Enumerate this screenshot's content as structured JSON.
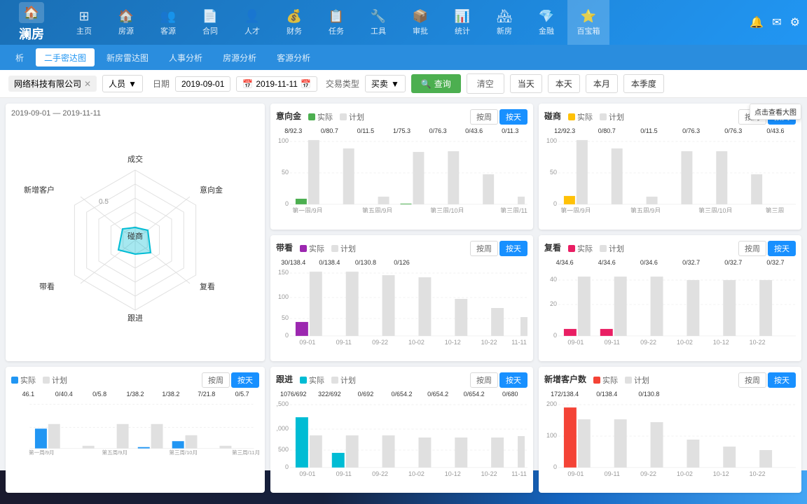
{
  "logo": {
    "name": "澜房",
    "icon": "🏠"
  },
  "nav": {
    "items": [
      {
        "id": "home",
        "icon": "⊞",
        "label": "主页"
      },
      {
        "id": "house",
        "icon": "🏠",
        "label": "房源"
      },
      {
        "id": "customer",
        "icon": "👥",
        "label": "客源"
      },
      {
        "id": "contract",
        "icon": "📄",
        "label": "合同"
      },
      {
        "id": "staff",
        "icon": "👤",
        "label": "人才"
      },
      {
        "id": "finance",
        "icon": "💰",
        "label": "财务"
      },
      {
        "id": "task",
        "icon": "📋",
        "label": "任务"
      },
      {
        "id": "tools",
        "icon": "🔧",
        "label": "工具"
      },
      {
        "id": "batch",
        "icon": "📦",
        "label": "审批"
      },
      {
        "id": "stats",
        "icon": "📊",
        "label": "统计"
      },
      {
        "id": "newhouse",
        "icon": "🏘",
        "label": "新房"
      },
      {
        "id": "gold",
        "icon": "💎",
        "label": "金融"
      },
      {
        "id": "baobao",
        "icon": "⭐",
        "label": "百宝箱"
      }
    ],
    "active": "baobao"
  },
  "sub_nav": {
    "items": [
      {
        "id": "other",
        "label": "析"
      },
      {
        "id": "secondhand",
        "label": "二手密达图"
      },
      {
        "id": "newhouse",
        "label": "新房雷达图"
      },
      {
        "id": "hr",
        "label": "人事分析"
      },
      {
        "id": "house_analysis",
        "label": "房源分析"
      },
      {
        "id": "customer_analysis",
        "label": "客源分析"
      }
    ],
    "active": "secondhand"
  },
  "filter": {
    "company": "网络科技有限公司",
    "person_type": "人员",
    "date_label": "日期",
    "date_start": "2019-09-01",
    "date_end": "2019-11-11",
    "trade_type_label": "交易类型",
    "trade_type": "买卖",
    "btn_query": "查询",
    "btn_clear": "清空",
    "btn_today": "当天",
    "btn_week": "本天",
    "btn_month": "本月",
    "btn_quarter": "本季度"
  },
  "radar": {
    "date_range": "2019-09-01 — 2019-11-11",
    "labels": [
      "成交",
      "意向金",
      "新增客户",
      "跟进",
      "带看",
      "复看",
      "碰商"
    ],
    "values": [
      0.1,
      0.15,
      0.08,
      0.2,
      0.18,
      0.12,
      0.1
    ]
  },
  "charts": {
    "yixiangjin": {
      "title": "意向金",
      "legend": [
        "实际",
        "计划"
      ],
      "colors": [
        "#4caf50",
        "#e0e0e0"
      ],
      "values": [
        "8/92.3",
        "0/80.7",
        "0/11.5",
        "1/75.3",
        "0/76.3",
        "0/43.6",
        "0/11.3"
      ],
      "x_labels": [
        "第一周/9月",
        "",
        "第五周/9月",
        "",
        "第三周/10月",
        "",
        "第三周/11月"
      ],
      "bar_data": [
        {
          "actual": 8,
          "plan": 92
        },
        {
          "actual": 0,
          "plan": 80
        },
        {
          "actual": 0,
          "plan": 11
        },
        {
          "actual": 1,
          "plan": 75
        },
        {
          "actual": 0,
          "plan": 76
        },
        {
          "actual": 0,
          "plan": 43
        },
        {
          "actual": 0,
          "plan": 11
        }
      ],
      "btn_active": "按周"
    },
    "pengshang": {
      "title": "碰商",
      "legend": [
        "实际",
        "计划"
      ],
      "colors": [
        "#ffc107",
        "#e0e0e0"
      ],
      "values": [
        "12/92.3",
        "0/80.7",
        "0/11.5",
        "0/76.3",
        "0/76.3",
        "0/43.6"
      ],
      "x_labels": [
        "第一周/9月",
        "",
        "第五周/9月",
        "",
        "第三周/10月",
        "",
        "第三周"
      ],
      "bar_data": [
        {
          "actual": 12,
          "plan": 92
        },
        {
          "actual": 0,
          "plan": 80
        },
        {
          "actual": 0,
          "plan": 11
        },
        {
          "actual": 0,
          "plan": 76
        },
        {
          "actual": 0,
          "plan": 76
        },
        {
          "actual": 0,
          "plan": 43
        }
      ],
      "tooltip": "点击查看大图",
      "btn_active": "按周"
    },
    "dankuan": {
      "title": "带看",
      "legend": [
        "实际",
        "计划"
      ],
      "colors": [
        "#9c27b0",
        "#e0e0e0"
      ],
      "values": [
        "30/138.4",
        "0/138.4",
        "0/130.8",
        "0/126",
        "",
        "",
        ""
      ],
      "x_labels": [
        "09-01",
        "09-11",
        "09-22",
        "10-02",
        "10-12",
        "10-22",
        "11-11"
      ],
      "bar_data": [
        {
          "actual": 30,
          "plan": 138
        },
        {
          "actual": 0,
          "plan": 138
        },
        {
          "actual": 0,
          "plan": 130
        },
        {
          "actual": 0,
          "plan": 126
        },
        {
          "actual": 0,
          "plan": 80
        },
        {
          "actual": 0,
          "plan": 60
        },
        {
          "actual": 0,
          "plan": 40
        }
      ],
      "btn_active": "按天"
    },
    "fukan": {
      "title": "复看",
      "legend": [
        "实际",
        "计划"
      ],
      "colors": [
        "#e91e63",
        "#e0e0e0"
      ],
      "values": [
        "4/34.6",
        "4/34.6",
        "0/34.6",
        "0/32.7",
        "0/32.7",
        "0/32.7"
      ],
      "x_labels": [
        "09-01",
        "09-11",
        "09-22",
        "10-02",
        "10-12",
        "10-22"
      ],
      "bar_data": [
        {
          "actual": 4,
          "plan": 34
        },
        {
          "actual": 4,
          "plan": 34
        },
        {
          "actual": 0,
          "plan": 34
        },
        {
          "actual": 0,
          "plan": 32
        },
        {
          "actual": 0,
          "plan": 32
        },
        {
          "actual": 0,
          "plan": 32
        }
      ],
      "btn_active": "按周"
    },
    "genjin": {
      "title": "跟进",
      "legend": [
        "实际",
        "计划"
      ],
      "colors": [
        "#00bcd4",
        "#e0e0e0"
      ],
      "values": [
        "1076/692",
        "322/692",
        "0/692",
        "0/654.2",
        "0/654.2",
        "0/654.2",
        "0/680"
      ],
      "x_labels": [
        "09-01",
        "09-11",
        "09-22",
        "10-02",
        "10-12",
        "10-22",
        "11-11"
      ],
      "bar_data": [
        {
          "actual": 1076,
          "plan": 692
        },
        {
          "actual": 322,
          "plan": 692
        },
        {
          "actual": 0,
          "plan": 692
        },
        {
          "actual": 0,
          "plan": 654
        },
        {
          "actual": 0,
          "plan": 654
        },
        {
          "actual": 0,
          "plan": 654
        },
        {
          "actual": 0,
          "plan": 680
        }
      ],
      "y_max": 1500,
      "btn_active": "按天"
    },
    "xinkehushu": {
      "title": "新增客户数",
      "legend": [
        "实际",
        "计划"
      ],
      "colors": [
        "#f44336",
        "#e0e0e0"
      ],
      "values": [
        "172/138.4",
        "0/138.4",
        "0/130.8",
        "",
        "",
        "",
        ""
      ],
      "x_labels": [
        "09-01",
        "09-11",
        "09-22",
        "10-02",
        "10-12",
        "10-22"
      ],
      "bar_data": [
        {
          "actual": 172,
          "plan": 138
        },
        {
          "actual": 0,
          "plan": 138
        },
        {
          "actual": 0,
          "plan": 130
        },
        {
          "actual": 0,
          "plan": 80
        },
        {
          "actual": 0,
          "plan": 60
        },
        {
          "actual": 0,
          "plan": 50
        }
      ],
      "btn_active": "按周"
    }
  },
  "bottom_left": {
    "title": "",
    "legend": [
      "实际",
      "计划"
    ],
    "values": [
      "46.1",
      "0/40.4",
      "0/5.8",
      "1/38.2",
      "1/38.2",
      "7/21.8",
      "0/5.7"
    ],
    "x_labels": [
      "第一周/9月",
      "",
      "第五周/9月",
      "",
      "第三周/10月",
      "",
      "第三周/11月"
    ]
  }
}
